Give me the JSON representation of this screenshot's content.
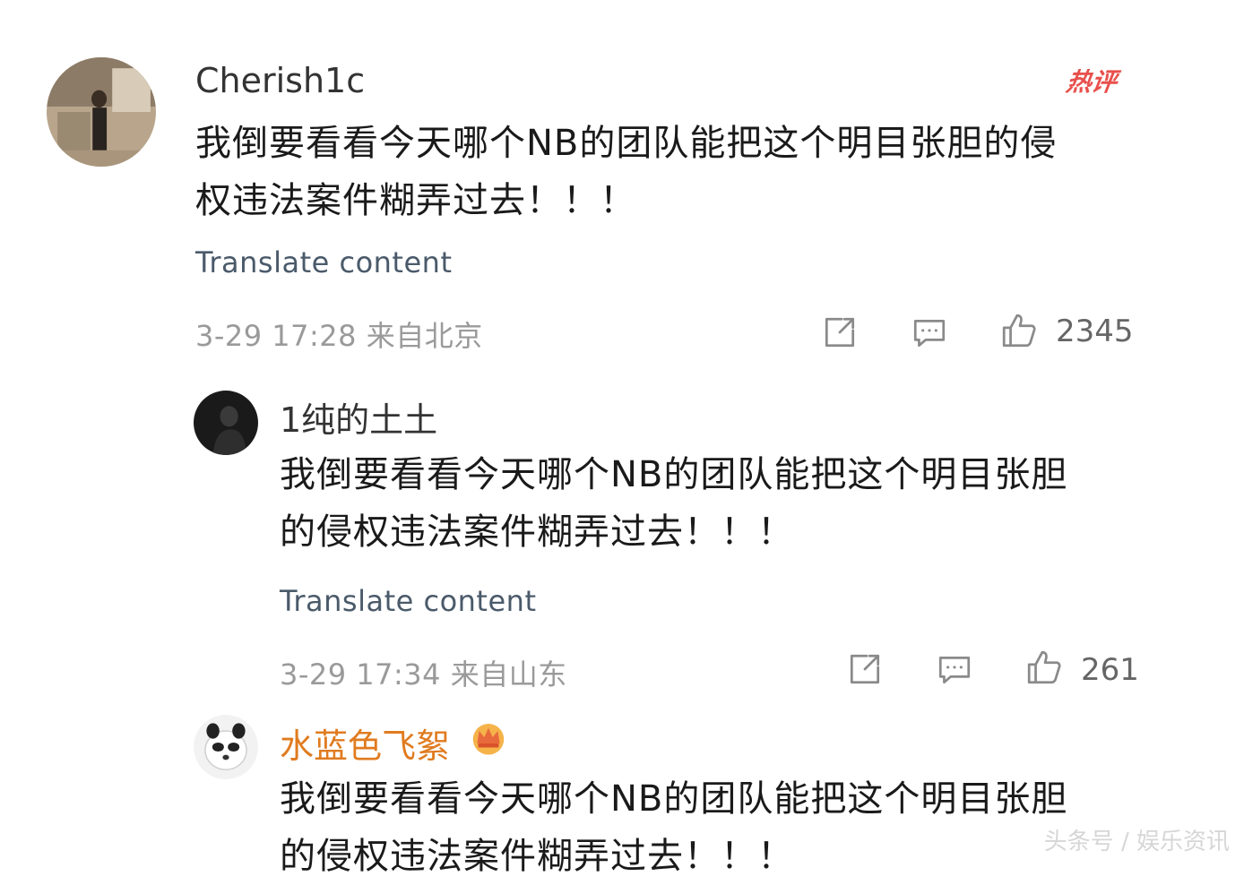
{
  "comments": [
    {
      "username": "Cherish1c",
      "hot_badge": "热评",
      "text_line1": "我倒要看看今天哪个NB的团队能把这个明目张胆的侵",
      "text_line2": "权违法案件糊弄过去！！！",
      "translate": "Translate content",
      "timestamp": "3-29 17:28 来自北京",
      "likes": "2345"
    },
    {
      "username": "1纯的土土",
      "text_line1": "我倒要看看今天哪个NB的团队能把这个明目张胆",
      "text_line2": "的侵权违法案件糊弄过去！！！",
      "translate": "Translate content",
      "timestamp": "3-29 17:34 来自山东",
      "likes": "261"
    },
    {
      "username": "水蓝色飞絮",
      "username_color": "#e07b1f",
      "text_line1": "我倒要看看今天哪个NB的团队能把这个明目张胆",
      "text_line2": "的侵权违法案件糊弄过去！！！"
    }
  ],
  "watermark": "头条号 / 娱乐资讯",
  "icons": [
    "share-icon",
    "comment-icon",
    "like-icon",
    "crown-icon"
  ]
}
